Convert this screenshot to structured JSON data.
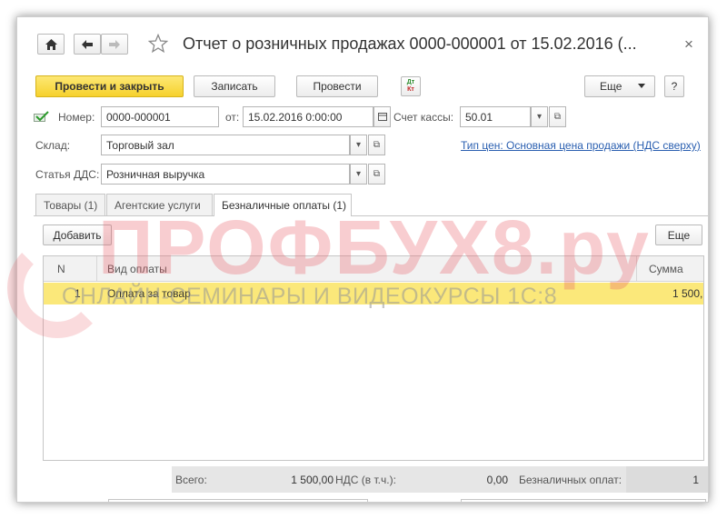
{
  "window": {
    "title": "Отчет о розничных продажах 0000-000001 от 15.02.2016 (...",
    "close": "×"
  },
  "nav": {
    "home_icon": "home-icon",
    "back_icon": "arrow-left-icon",
    "forward_icon": "arrow-right-icon",
    "star_icon": "star-outline-icon"
  },
  "toolbar": {
    "post_close_label": "Провести и закрыть",
    "save_label": "Записать",
    "post_label": "Провести",
    "dt_kt_top": "Дт",
    "dt_kt_bottom": "Кт",
    "more_label": "Еще",
    "help_label": "?"
  },
  "header": {
    "number_label": "Номер:",
    "number_value": "0000-000001",
    "date_label": "от:",
    "date_value": "15.02.2016  0:00:00",
    "cash_account_label": "Счет кассы:",
    "cash_account_value": "50.01",
    "warehouse_label": "Склад:",
    "warehouse_value": "Торговый зал",
    "price_type_link": "Тип цен: Основная цена продажи (НДС сверху)",
    "dds_label": "Статья ДДС:",
    "dds_value": "Розничная выручка"
  },
  "tabs": [
    {
      "label": "Товары (1)"
    },
    {
      "label": "Агентские услуги"
    },
    {
      "label": "Безналичные оплаты (1)"
    }
  ],
  "table": {
    "add_label": "Добавить",
    "more_label": "Еще",
    "columns": [
      "N",
      "Вид оплаты",
      "Сумма"
    ],
    "rows": [
      {
        "n": "1",
        "payment_type": "Оплата за товар",
        "amount": "1 500,",
        "selected": true
      }
    ]
  },
  "footer": {
    "total_label": "Всего:",
    "total_value": "1 500,00",
    "vat_label": "НДС (в т.ч.):",
    "vat_value": "0,00",
    "cashless_label": "Безналичных оплат:",
    "cashless_value": "1"
  },
  "watermark": {
    "logo": "ПРОФБУХ8.ру",
    "subtitle": "ОНЛАЙН-СЕМИНАРЫ И ВИДЕОКУРСЫ 1С:8"
  },
  "colors": {
    "accent_button": "#f6d12d",
    "selected_row": "#fbe87a",
    "link": "#2a5fb0",
    "watermark_red": "#e85a64"
  }
}
